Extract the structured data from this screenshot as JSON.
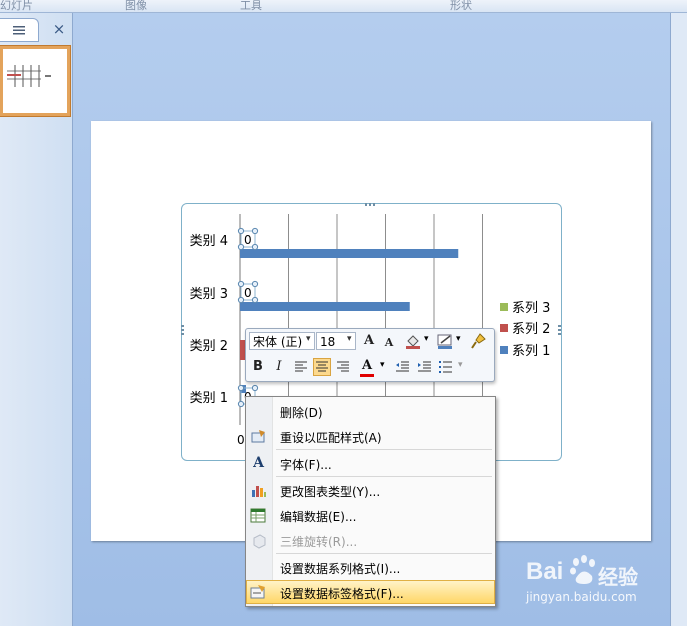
{
  "ribbon": {
    "groups": [
      "幻灯片",
      "图像",
      "工具",
      "形状"
    ]
  },
  "left_pane": {
    "close_glyph": "×"
  },
  "chart": {
    "categories": [
      "类别 1",
      "类别 2",
      "类别 3",
      "类别 4"
    ],
    "series": [
      {
        "name": "系列 1"
      },
      {
        "name": "系列 2"
      },
      {
        "name": "系列 3"
      }
    ],
    "data_label": "0",
    "x_tick": "0"
  },
  "chart_data": {
    "type": "bar",
    "categories": [
      "类别 1",
      "类别 2",
      "类别 3",
      "类别 4"
    ],
    "series": [
      {
        "name": "系列 1",
        "values": [
          null,
          null,
          3.5,
          4.5
        ]
      },
      {
        "name": "系列 2",
        "values": [
          null,
          null,
          0,
          0
        ]
      },
      {
        "name": "系列 3",
        "values": [
          null,
          null,
          0,
          0
        ]
      }
    ],
    "legend": "right",
    "grid": true
  },
  "colors": {
    "series1": "#4f81bd",
    "series2": "#c0504d",
    "series3": "#9bbb59"
  },
  "mini_toolbar": {
    "font_name": "宋体 (正)",
    "font_size": "18",
    "grow_font": "A",
    "shrink_font": "A",
    "bold": "B",
    "italic": "I",
    "font_color": "A"
  },
  "context_menu": {
    "items": [
      {
        "label": "删除(D)",
        "icon": "none"
      },
      {
        "label": "重设以匹配样式(A)",
        "icon": "reset-style-icon"
      },
      {
        "label": "字体(F)...",
        "icon": "font-icon"
      },
      {
        "label": "更改图表类型(Y)...",
        "icon": "chart-type-icon"
      },
      {
        "label": "编辑数据(E)...",
        "icon": "edit-data-icon"
      },
      {
        "label": "三维旋转(R)...",
        "icon": "rotate-3d-icon"
      },
      {
        "label": "设置数据系列格式(I)...",
        "icon": "none"
      },
      {
        "label": "设置数据标签格式(F)...",
        "icon": "format-label-icon"
      }
    ]
  },
  "watermark": {
    "brand": "Bai",
    "brand2": "经验",
    "url": "jingyan.baidu.com"
  }
}
